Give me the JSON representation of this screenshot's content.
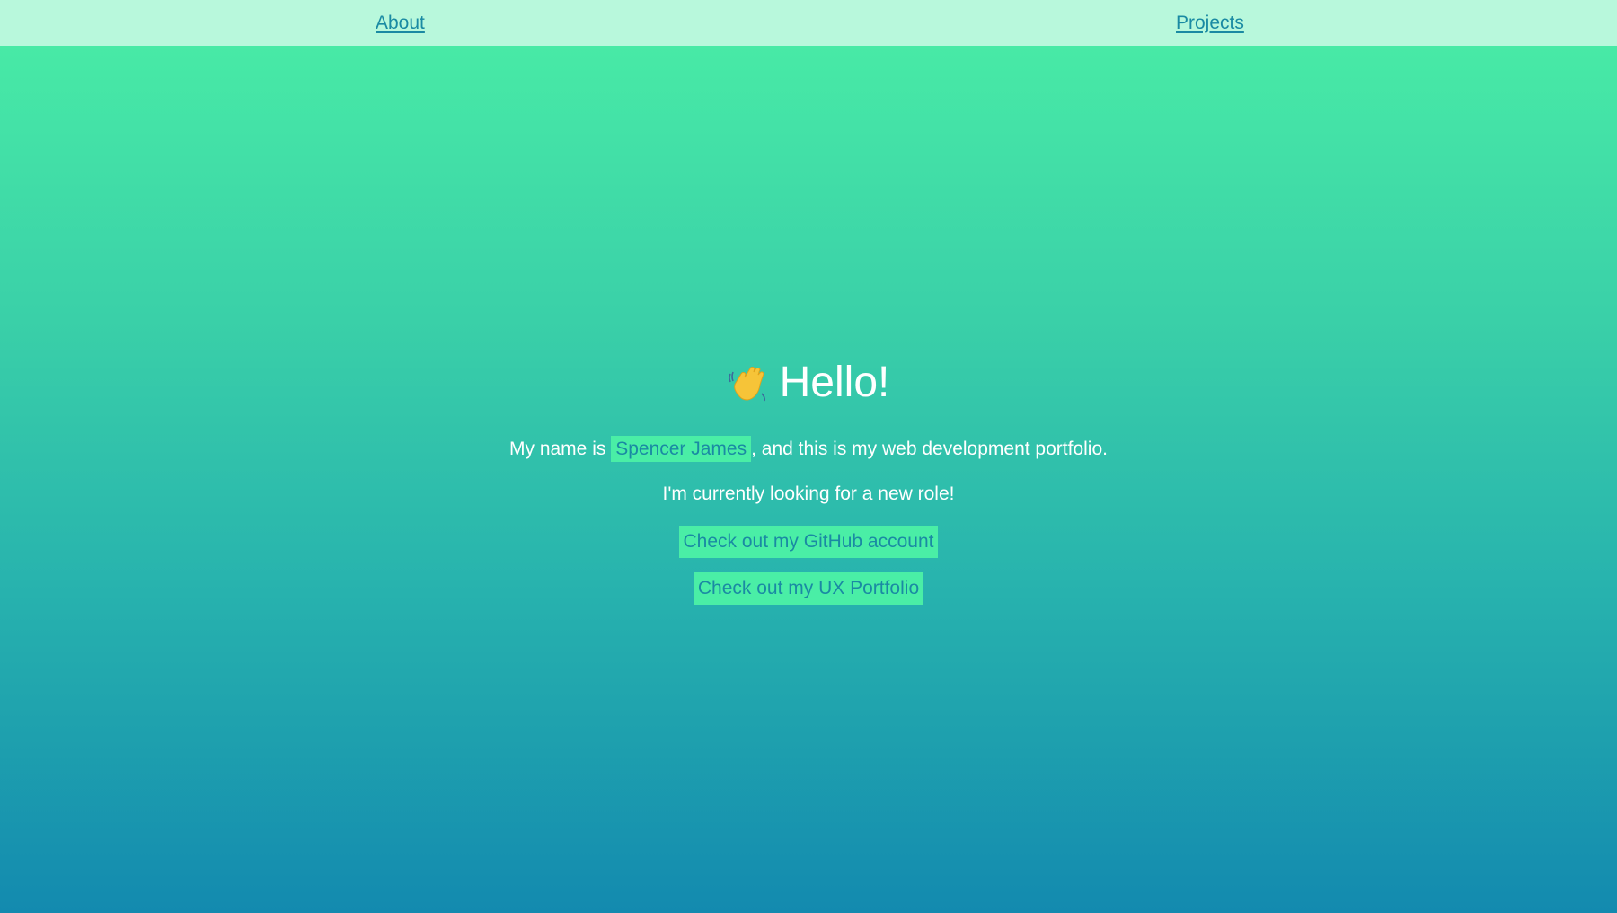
{
  "nav": {
    "about_label": "About",
    "projects_label": "Projects"
  },
  "hero": {
    "title": "Hello!",
    "icon": "waving-hand-icon",
    "intro_prefix": "My name is ",
    "name": "Spencer James",
    "intro_suffix": ", and this is my web development portfolio.",
    "looking": "I'm currently looking for a new role!",
    "github_label": "Check out my GitHub account",
    "ux_label": "Check out my UX Portfolio"
  },
  "colors": {
    "nav_bg": "#b8f8dc",
    "accent": "#4aeea6",
    "link_text": "#1a8aa3",
    "gradient_top": "#4aeea6",
    "gradient_bottom": "#138aaf"
  }
}
